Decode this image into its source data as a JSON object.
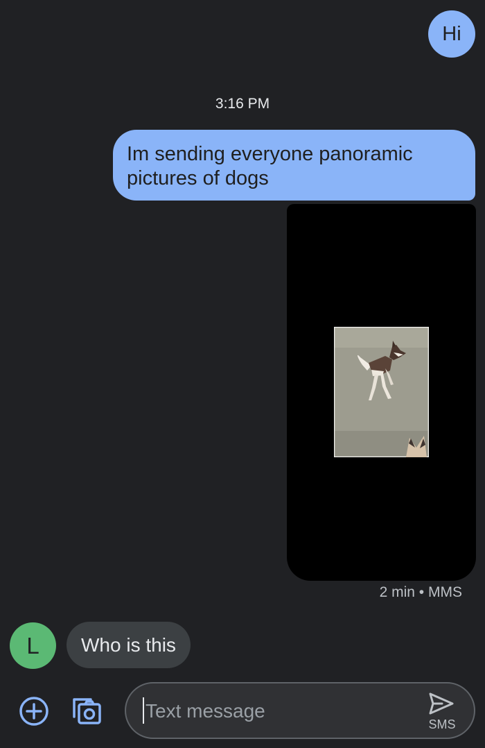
{
  "conversation": {
    "messages": [
      {
        "direction": "outgoing",
        "text": "Hi"
      },
      {
        "direction": "outgoing",
        "text": "Im sending everyone panoramic pictures of dogs"
      },
      {
        "direction": "outgoing",
        "type": "image",
        "meta": "2 min • MMS"
      },
      {
        "direction": "incoming",
        "text": "Who is this",
        "sender_initial": "L"
      }
    ],
    "timestamp": "3:16 PM"
  },
  "compose": {
    "placeholder": "Text message",
    "send_label": "SMS"
  },
  "icons": {
    "add": "add-circle-icon",
    "gallery": "camera-gallery-icon",
    "send": "send-icon"
  },
  "colors": {
    "background": "#202124",
    "outgoing_bubble": "#8ab4f8",
    "incoming_bubble": "#3c4043",
    "avatar": "#5bb974",
    "accent": "#8ab4f8"
  }
}
